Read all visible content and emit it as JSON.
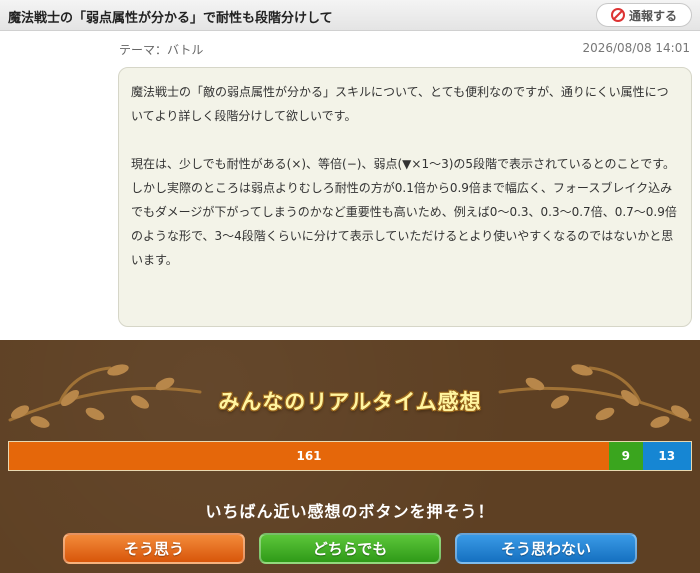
{
  "header": {
    "title": "魔法戦士の「弱点属性が分かる」で耐性も段階分けして",
    "report_label": "通報する"
  },
  "post": {
    "theme": "テーマ：バトル",
    "datetime": "2026/08/08 14:01",
    "paragraphs": [
      "魔法戦士の「敵の弱点属性が分かる」スキルについて、とても便利なのですが、通りにくい属性についてより詳しく段階分けして欲しいです。",
      "現在は、少しでも耐性がある(×)、等倍(−)、弱点(▼×1〜3)の5段階で表示されているとのことです。",
      "しかし実際のところは弱点よりむしろ耐性の方が0.1倍から0.9倍まで幅広く、フォースブレイク込みでもダメージが下がってしまうのかなど重要性も高いため、例えば0〜0.3、0.3〜0.7倍、0.7〜0.9倍のような形で、3〜4段階くらいに分けて表示していただけるとより使いやすくなるのではないかと思います。"
    ]
  },
  "reactions": {
    "title": "みんなのリアルタイム感想",
    "counts": {
      "agree": "161",
      "either": "9",
      "disagree": "13"
    },
    "values": {
      "agree": 161,
      "either": 9,
      "disagree": 13
    },
    "prompt": "いちばん近い感想のボタンを押そう！",
    "buttons": {
      "agree": "そう思う",
      "either": "どちらでも",
      "disagree": "そう思わない"
    }
  },
  "colors": {
    "agree": "#e5670a",
    "either": "#3aa51e",
    "disagree": "#1686d3",
    "brown_bg": "#5e4023"
  },
  "icons": {
    "report": "prohibited-icon",
    "decoration": "vine-ornament"
  }
}
